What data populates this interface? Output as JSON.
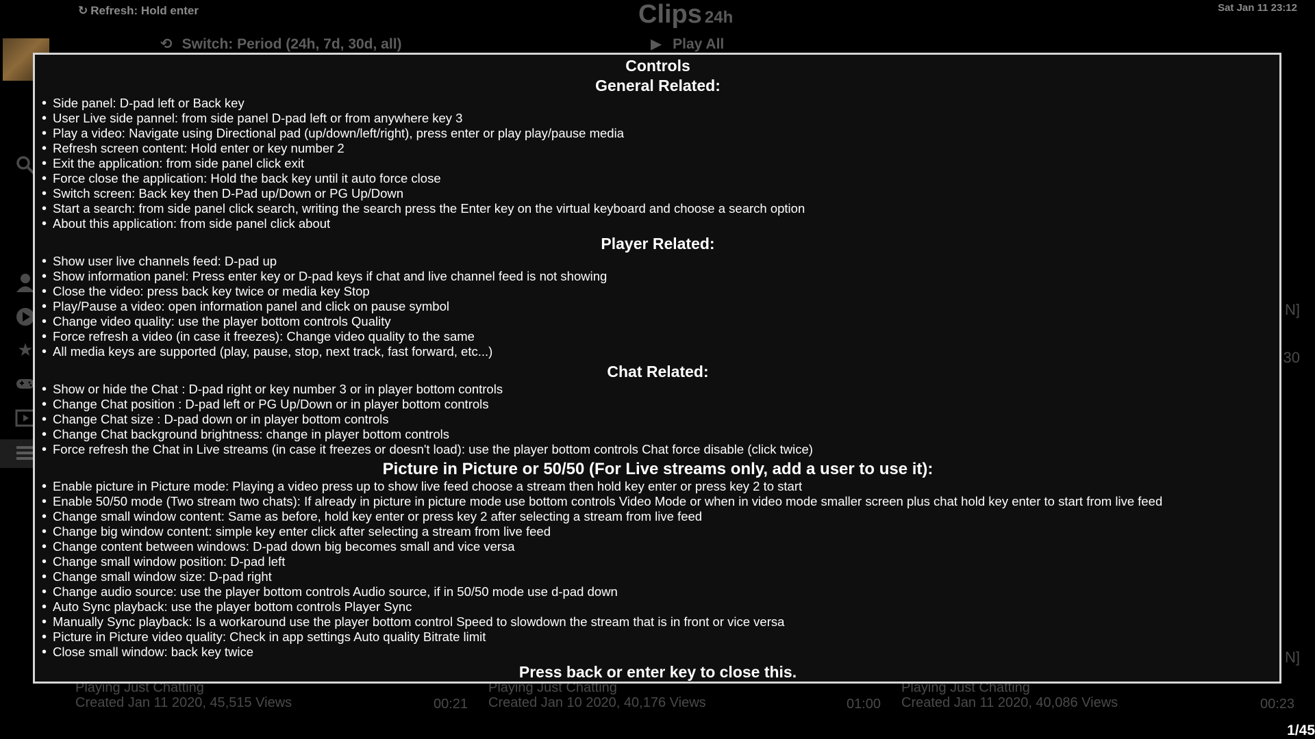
{
  "header": {
    "refresh_hint": "Refresh: Hold enter",
    "switch_hint": "Switch: Period (24h, 7d, 30d, all)",
    "title": "Clips",
    "period": "24h",
    "play_all": "Play All",
    "clock": "Sat Jan 11 23:12"
  },
  "edge_labels": [
    "N]",
    "30",
    "N]"
  ],
  "clips": [
    {
      "game": "Playing Just Chatting",
      "created": "Created Jan 11 2020, 45,515 Views",
      "duration": "00:21"
    },
    {
      "game": "Playing Just Chatting",
      "created": "Created Jan 10 2020, 40,176 Views",
      "duration": "01:00"
    },
    {
      "game": "Playing Just Chatting",
      "created": "Created Jan 11 2020, 40,086 Views",
      "duration": "00:23"
    }
  ],
  "pagination": "1/45",
  "dialog": {
    "title": "Controls",
    "sections": [
      {
        "title": "General Related:",
        "items": [
          "Side panel: D-pad left or Back key",
          "User Live side pannel: from side panel D-pad left or from anywhere key 3",
          "Play a video: Navigate using Directional pad (up/down/left/right), press enter or play play/pause media",
          "Refresh screen content: Hold enter or key number 2",
          "Exit the application: from side panel click exit",
          "Force close the application: Hold the back key until it auto force close",
          "Switch screen: Back key then D-Pad up/Down or PG Up/Down",
          "Start a search: from side panel click search, writing the search press the Enter key on the virtual keyboard and choose a search option",
          "About this application: from side panel click about"
        ]
      },
      {
        "title": "Player Related:",
        "items": [
          "Show user live channels feed: D-pad up",
          "Show information panel: Press enter key or D-pad keys if chat and live channel feed is not showing",
          "Close the video: press back key twice or media key Stop",
          "Play/Pause a video: open information panel and click on pause symbol",
          "Change video quality: use the player bottom controls Quality",
          "Force refresh a video (in case it freezes): Change video quality to the same",
          "All media keys are supported (play, pause, stop, next track, fast forward, etc...)"
        ]
      },
      {
        "title": "Chat Related:",
        "items": [
          "Show or hide the Chat : D-pad right or key number 3 or in player bottom controls",
          "Change Chat position : D-pad left or PG Up/Down or in player bottom controls",
          "Change Chat size : D-pad down or in player bottom controls",
          "Change Chat background brightness: change in player bottom controls",
          "Force refresh the Chat in Live streams (in case it freezes or doesn't load): use the player bottom controls Chat force disable (click twice)"
        ]
      },
      {
        "title": "Picture in Picture or 50/50 (For Live streams only, add a user to use it):",
        "items": [
          "Enable picture in Picture mode: Playing a video press up to show live feed choose a stream then hold key enter or press key 2 to start",
          "Enable 50/50 mode (Two stream two chats): If already in picture in picture mode use bottom controls Video Mode or when in video mode smaller screen plus chat hold key enter to start from live feed",
          "Change small window content: Same as before, hold key enter or press key 2 after selecting a stream from live feed",
          "Change big window content: simple key enter click after selecting a stream from live feed",
          "Change content between windows: D-pad down big becomes small and vice versa",
          "Change small window position: D-pad left",
          "Change small window size: D-pad right",
          "Change audio source: use the player bottom controls Audio source, if in 50/50 mode use d-pad down",
          "Auto Sync playback: use the player bottom controls Player Sync",
          "Manually Sync playback: Is a workaround use the player bottom control Speed to slowdown the stream that is in front or vice versa",
          "Picture in Picture video quality: Check in app settings Auto quality Bitrate limit",
          "Close small window: back key twice"
        ]
      }
    ],
    "footer": "Press back or enter key to close this."
  }
}
